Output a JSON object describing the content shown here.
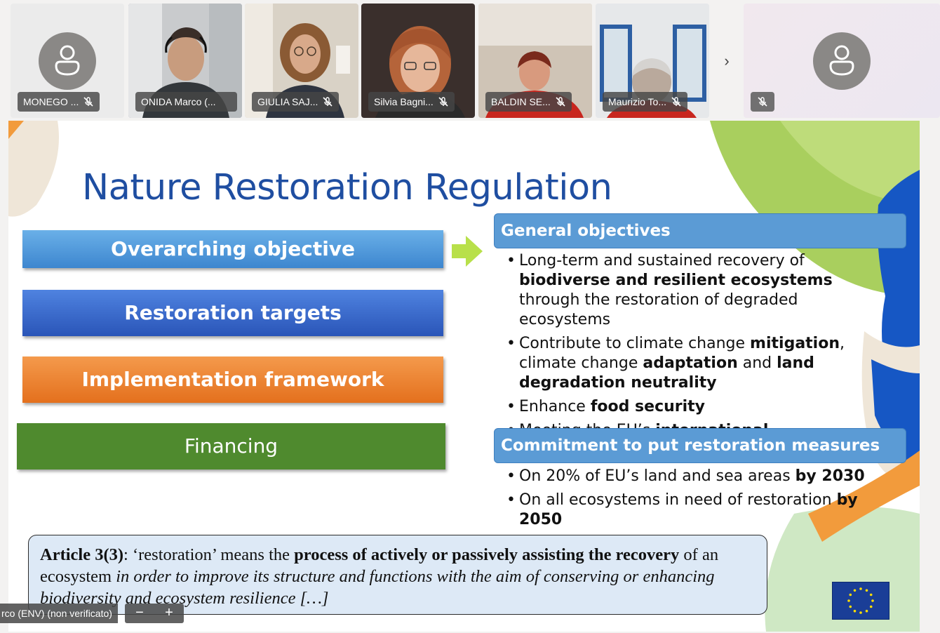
{
  "participants": [
    {
      "name": "MONEGO ...",
      "has_video": false,
      "active": false
    },
    {
      "name": "ONIDA Marco (...",
      "has_video": true,
      "active": true
    },
    {
      "name": "GIULIA SAJ...",
      "has_video": true,
      "active": false
    },
    {
      "name": "Silvia Bagni...",
      "has_video": true,
      "active": false
    },
    {
      "name": "BALDIN SE...",
      "has_video": true,
      "active": false
    },
    {
      "name": "Maurizio To...",
      "has_video": true,
      "active": false
    }
  ],
  "strip": {
    "next_icon": "chevron-right-icon",
    "next_glyph": "›"
  },
  "slide": {
    "title": "Nature Restoration Regulation",
    "left_boxes": {
      "overarching": "Overarching objective",
      "targets": "Restoration targets",
      "framework": "Implementation framework",
      "financing": "Financing"
    },
    "general_objectives": {
      "header": "General objectives",
      "b1_pre": "Long-term and sustained recovery of ",
      "b1_bold": "biodiverse and resilient ecosystems",
      "b1_post": " through the restoration of degraded ecosystems",
      "b2_pre": "Contribute to climate change ",
      "b2_bold1": "mitigation",
      "b2_mid1": ", climate change ",
      "b2_bold2": "adaptation",
      "b2_mid2": " and ",
      "b2_bold3": "land degradation neutrality",
      "b3_pre": "Enhance ",
      "b3_bold": "food security",
      "b4_pre": "Meeting the EU’s ",
      "b4_bold": "international commitments"
    },
    "commitment": {
      "header": "Commitment to put restoration measures",
      "b1_pre": "On 20% of EU’s land and sea areas ",
      "b1_bold": "by 2030",
      "b2_pre": "On all ecosystems in need of restoration ",
      "b2_bold": "by 2050"
    },
    "article": {
      "label": "Article 3(3)",
      "text1": ": ‘restoration’ means the ",
      "bold": "process of actively or passively assisting the recovery",
      "text2": " of an ecosystem ",
      "italic": "in order to improve its structure and functions with the aim of conserving or enhancing biodiversity and ecosystem resilience […]"
    }
  },
  "overlay": {
    "presenter_label": "rco (ENV) (non verificato)",
    "zoom_out": "−",
    "zoom_in": "+"
  },
  "colors": {
    "title_blue": "#1f4ea1",
    "active_outline": "#6264a7",
    "header_blue": "#5b9bd5",
    "financing_green": "#4f8a2e",
    "framework_orange": "#e4701d"
  }
}
